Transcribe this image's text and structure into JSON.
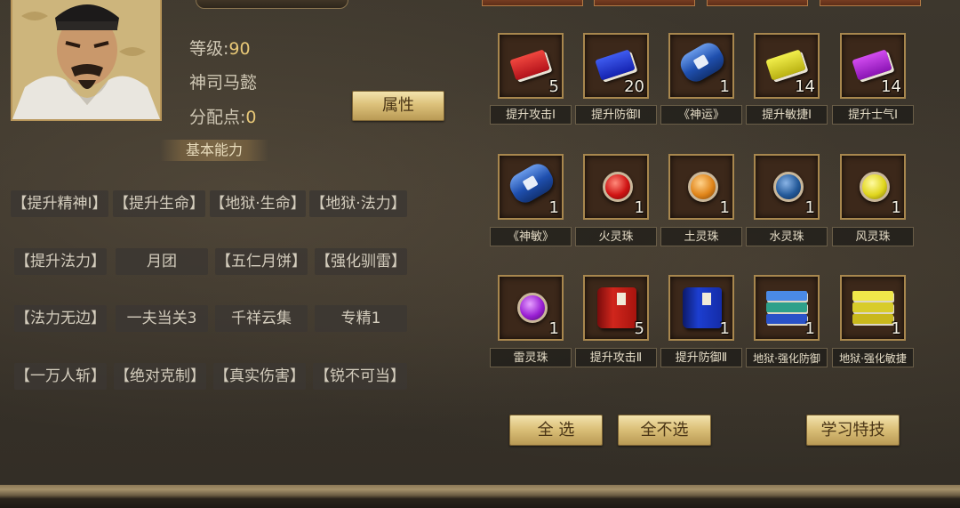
{
  "character": {
    "level_label": "等级:",
    "level_value": "90",
    "title": "神司马懿",
    "points_label": "分配点:",
    "points_value": "0",
    "attr_button": "属性"
  },
  "skills_section": {
    "title": "基本能力",
    "skills": [
      "【提升精神Ⅰ】",
      "【提升生命】",
      "【地狱·生命】",
      "【地狱·法力】",
      "【提升法力】",
      "月团",
      "【五仁月饼】",
      "【强化驯雷】",
      "【法力无边】",
      "一夫当关3",
      "千祥云集",
      "专精1",
      "【一万人斩】",
      "【绝对克制】",
      "【真实伤害】",
      "【锐不可当】"
    ]
  },
  "items": [
    {
      "label": "提升攻击Ⅰ",
      "count": "5",
      "icon": "red-book-icon"
    },
    {
      "label": "提升防御Ⅰ",
      "count": "20",
      "icon": "blue-book-icon"
    },
    {
      "label": "《神运》",
      "count": "1",
      "icon": "blue-scroll-icon"
    },
    {
      "label": "提升敏捷Ⅰ",
      "count": "14",
      "icon": "yellow-book-icon"
    },
    {
      "label": "提升士气Ⅰ",
      "count": "14",
      "icon": "purple-book-icon"
    },
    {
      "label": "《神敏》",
      "count": "1",
      "icon": "blue-scroll-icon"
    },
    {
      "label": "火灵珠",
      "count": "1",
      "icon": "red-orb-icon"
    },
    {
      "label": "土灵珠",
      "count": "1",
      "icon": "orange-orb-icon"
    },
    {
      "label": "水灵珠",
      "count": "1",
      "icon": "blue-orb-icon"
    },
    {
      "label": "风灵珠",
      "count": "1",
      "icon": "yellow-orb-icon"
    },
    {
      "label": "雷灵珠",
      "count": "1",
      "icon": "purple-orb-icon"
    },
    {
      "label": "提升攻击Ⅱ",
      "count": "5",
      "icon": "red-tome-icon"
    },
    {
      "label": "提升防御Ⅱ",
      "count": "1",
      "icon": "blue-tome-icon"
    },
    {
      "label": "地狱·强化防御",
      "count": "1",
      "icon": "blue-book-stack-icon"
    },
    {
      "label": "地狱·强化敏捷",
      "count": "1",
      "icon": "yellow-book-stack-icon"
    }
  ],
  "actions": {
    "select_all": "全 选",
    "deselect_all": "全不选",
    "learn": "学习特技"
  },
  "colors": {
    "gold_text": "#e8c877",
    "button_gold": "#dcc17a",
    "slot_border": "#a8874e"
  }
}
